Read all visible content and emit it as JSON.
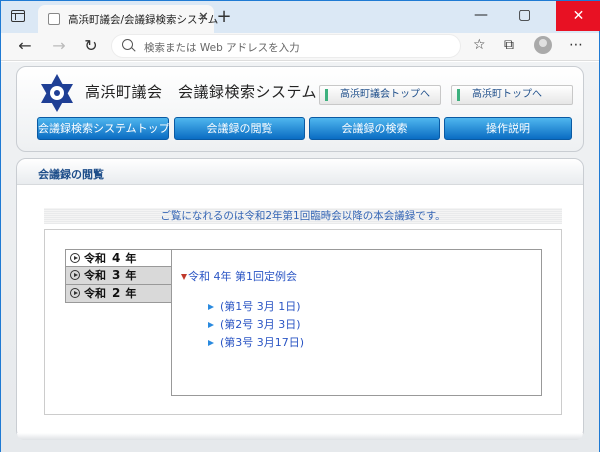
{
  "browser": {
    "tab_title": "高浜町議会/会議録検索システム",
    "tab_close": "✕",
    "new_tab": "+",
    "address_placeholder": "検索または Web アドレスを入力",
    "window_controls": [
      "—",
      "▢",
      "✕"
    ]
  },
  "site": {
    "title": "高浜町議会　会議録検索システム",
    "top_links": [
      "高浜町議会トップへ",
      "高浜町トップへ"
    ],
    "nav": [
      "会議録検索システムトップ",
      "会議録の閲覧",
      "会議録の検索",
      "操作説明"
    ]
  },
  "section": {
    "title": "会議録の閲覧",
    "notice": "ご覧になれるのは令和2年第1回臨時会以降の本会議録です。"
  },
  "years": [
    {
      "era": "令和",
      "num": "4",
      "suffix": "年"
    },
    {
      "era": "令和",
      "num": "3",
      "suffix": "年"
    },
    {
      "era": "令和",
      "num": "2",
      "suffix": "年"
    }
  ],
  "meeting": {
    "title": "令和 4年 第1回定例会",
    "issues": [
      "(第1号 3月 1日)",
      "(第2号 3月 3日)",
      "(第3号 3月17日)"
    ]
  },
  "colors": {
    "nav_button": "#1a84d6",
    "link_text": "#2a55c4",
    "close_button": "#e81123"
  }
}
